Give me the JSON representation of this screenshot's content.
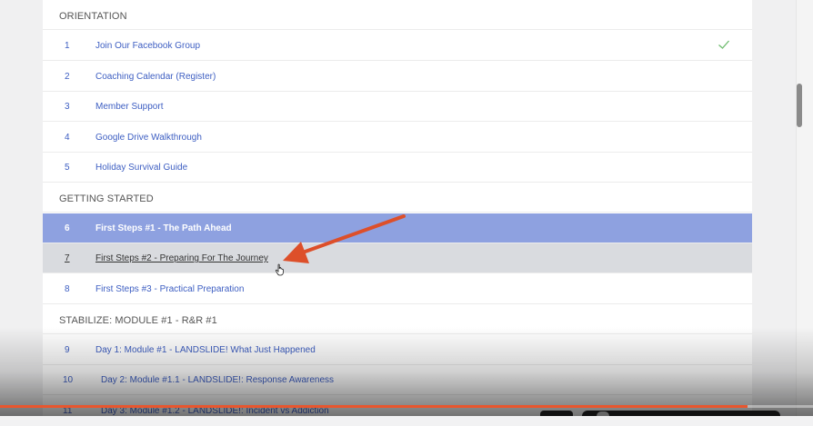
{
  "sections": [
    {
      "label": "ORIENTATION",
      "lessons": [
        {
          "num": "1",
          "title": "Join Our Facebook Group",
          "completed": true
        },
        {
          "num": "2",
          "title": "Coaching Calendar (Register)"
        },
        {
          "num": "3",
          "title": "Member Support"
        },
        {
          "num": "4",
          "title": "Google Drive Walkthrough"
        },
        {
          "num": "5",
          "title": "Holiday Survival Guide"
        }
      ]
    },
    {
      "label": "GETTING STARTED",
      "lessons": [
        {
          "num": "6",
          "title": "First Steps #1 - The Path Ahead",
          "state": "active"
        },
        {
          "num": "7",
          "title": "First Steps #2 - Preparing For The Journey",
          "state": "hover"
        },
        {
          "num": "8",
          "title": "First Steps #3 - Practical Preparation"
        }
      ]
    },
    {
      "label": "STABILIZE: MODULE #1 - R&R #1",
      "lessons": [
        {
          "num": "9",
          "title": "Day 1: Module #1 - LANDSLIDE! What Just Happened"
        },
        {
          "num": "10",
          "title": "Day 2: Module #1.1 - LANDSLIDE!: Response Awareness"
        },
        {
          "num": "11",
          "title": "Day 3: Module #1.2 - LANDSLIDE!: Incident vs Addiction"
        }
      ]
    }
  ],
  "icons": {
    "check": "check-icon",
    "cursor": "hand-pointer-icon",
    "annotation": "red-arrow"
  },
  "colors": {
    "accent_link": "#3d5ec2",
    "active_row": "#8ea1e0",
    "hover_row": "#d9dbdf",
    "check": "#6dbb6d",
    "annotation_arrow": "#dd4f2a",
    "video_progress": "#e8562e"
  },
  "video": {
    "progress": 0.92
  }
}
